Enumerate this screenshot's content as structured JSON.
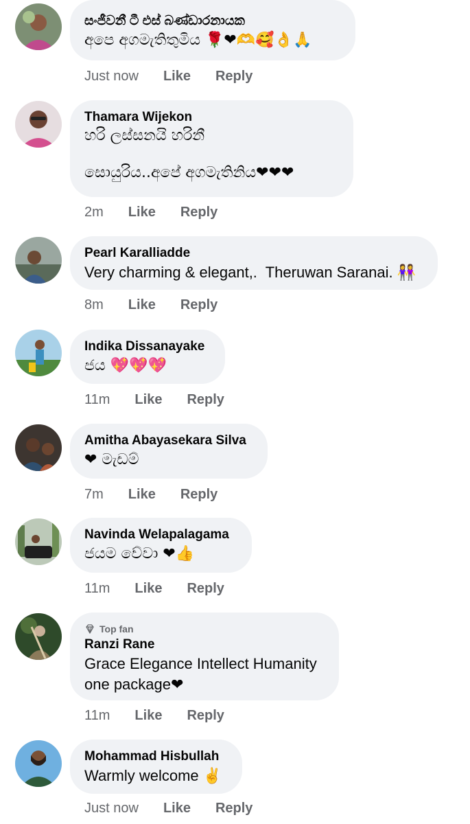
{
  "comments": [
    {
      "author": "සංජීවනී ටී එස් බණ්ඩාරනායක",
      "text": "අපෙ අගමැතිතුමිය 🌹❤🫶🥰👌🙏",
      "time": "Just now",
      "like": "Like",
      "reply": "Reply"
    },
    {
      "author": "Thamara Wijekon",
      "text": "හරි ලස්සනයි හරිනී\n\nසොයුරිය..අපේ අගමැතිනිය❤❤❤",
      "time": "2m",
      "like": "Like",
      "reply": "Reply"
    },
    {
      "author": "Pearl Karalliadde",
      "text": "Very charming & elegant,.  Theruwan Saranai. 👭",
      "time": "8m",
      "like": "Like",
      "reply": "Reply"
    },
    {
      "author": "Indika Dissanayake",
      "text": "ජය 💖💖💖",
      "time": "11m",
      "like": "Like",
      "reply": "Reply"
    },
    {
      "author": "Amitha Abayasekara Silva",
      "text": "❤ මැඩම්",
      "time": "7m",
      "like": "Like",
      "reply": "Reply"
    },
    {
      "author": "Navinda Welapalagama",
      "text": "ජයම වේවා ❤👍",
      "time": "11m",
      "like": "Like",
      "reply": "Reply"
    },
    {
      "author": "Ranzi Rane",
      "badge": "Top fan",
      "text": "Grace Elegance Intellect Humanity\none package❤",
      "time": "11m",
      "like": "Like",
      "reply": "Reply"
    },
    {
      "author": "Mohammad Hisbullah",
      "text": "Warmly welcome ✌",
      "time": "Just now",
      "like": "Like",
      "reply": "Reply"
    }
  ],
  "icons": {
    "badge": "diamond-icon"
  },
  "colors": {
    "bubble": "#f0f2f5",
    "meta": "#65676b",
    "text": "#050505"
  }
}
